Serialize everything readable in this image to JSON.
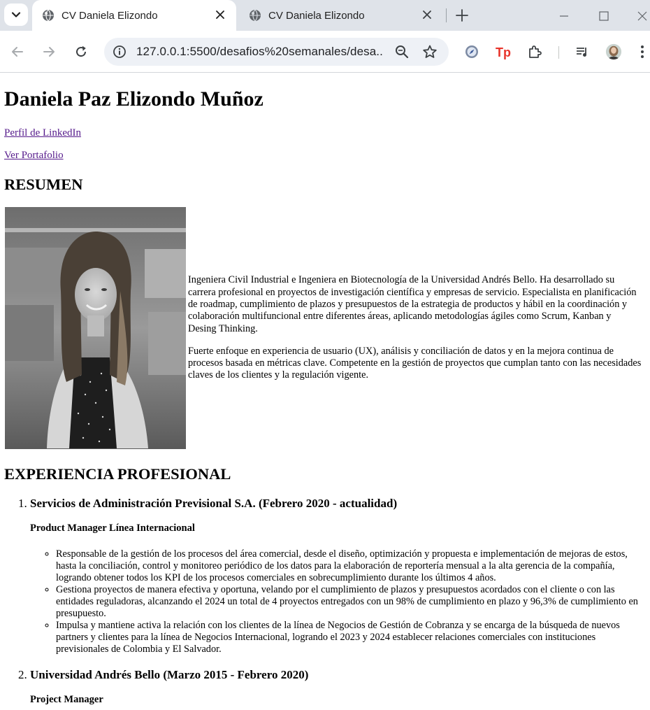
{
  "browser": {
    "tabs": [
      {
        "title": "CV Daniela Elizondo",
        "active": true
      },
      {
        "title": "CV Daniela Elizondo",
        "active": false
      }
    ],
    "url": "127.0.0.1:5500/desafios%20semanales/desa...",
    "icons": [
      "tab-search-icon",
      "globe-icon",
      "close-icon",
      "new-tab-icon",
      "minimize-icon",
      "maximize-icon",
      "window-close-icon",
      "back-icon",
      "forward-icon",
      "reload-icon",
      "site-info-icon",
      "zoom-icon",
      "bookmark-star-icon",
      "compass-extension-icon",
      "tp-extension-icon",
      "extensions-puzzle-icon",
      "media-queue-icon",
      "profile-avatar"
    ]
  },
  "cv": {
    "name": "Daniela Paz Elizondo Muñoz",
    "links": {
      "linkedin": "Perfil de LinkedIn",
      "portfolio": "Ver Portafolio"
    },
    "resumen": {
      "heading": "RESUMEN",
      "paragraphs": [
        "Ingeniera Civil Industrial e Ingeniera en Biotecnología de la Universidad Andrés Bello. Ha desarrollado su carrera profesional en proyectos de investigación científica y empresas de servicio. Especialista en planificación de roadmap, cumplimiento de plazos y presupuestos de la estrategia de productos y hábil en la coordinación y colaboración multifuncional entre diferentes áreas, aplicando metodologías ágiles como Scrum, Kanban y Desing Thinking.",
        "Fuerte enfoque en experiencia de usuario (UX), análisis y conciliación de datos y en la mejora continua de procesos basada en métricas clave. Competente en la gestión de proyectos que cumplan tanto con las necesidades claves de los clientes y la regulación vigente."
      ]
    },
    "experiencia": {
      "heading": "EXPERIENCIA PROFESIONAL",
      "jobs": [
        {
          "company": "Servicios de Administración Previsional S.A. (Febrero 2020 - actualidad)",
          "role": "Product Manager Línea Internacional",
          "duties": [
            "Responsable de la gestión de los procesos del área comercial, desde el diseño, optimización y propuesta e implementación de mejoras de estos, hasta la conciliación, control y monitoreo periódico de los datos para la elaboración de reportería mensual a la alta gerencia de la compañía, logrando obtener todos los KPI de los procesos comerciales en sobrecumplimiento durante los últimos 4 años.",
            "Gestiona proyectos de manera efectiva y oportuna, velando por el cumplimiento de plazos y presupuestos acordados con el cliente o con las entidades reguladoras, alcanzando el 2024 un total de 4 proyectos entregados con un 98% de cumplimiento en plazo y 96,3% de cumplimiento en presupuesto.",
            "Impulsa y mantiene activa la relación con los clientes de la línea de Negocios de Gestión de Cobranza y se encarga de la búsqueda de nuevos partners y clientes para la línea de Negocios Internacional, logrando el 2023 y 2024 establecer relaciones comerciales con instituciones previsionales de Colombia y El Salvador."
          ]
        },
        {
          "company": "Universidad Andrés Bello (Marzo 2015 - Febrero 2020)",
          "role": "Project Manager"
        }
      ]
    }
  }
}
